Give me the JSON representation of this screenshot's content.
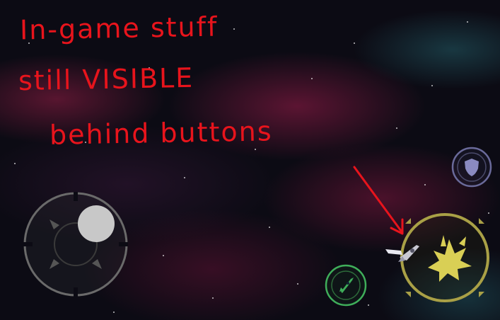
{
  "annotations": {
    "line1": "In-game stuff",
    "line2": "still VISIBLE",
    "line3": "behind buttons",
    "ink_color": "#e8141c"
  },
  "controls": {
    "joystick": {
      "icon": "directional-joystick-icon"
    },
    "fire_button": {
      "icon": "explosion-icon",
      "accent": "#a9a046"
    },
    "shield_button": {
      "icon": "shield-icon",
      "accent": "#6a6a9a"
    },
    "rocket_button": {
      "icon": "rocket-icon",
      "accent": "#3fae5a"
    }
  },
  "colors": {
    "background": "#0c0b14",
    "nebula_pink": "#961e46",
    "nebula_teal": "#286e78"
  }
}
